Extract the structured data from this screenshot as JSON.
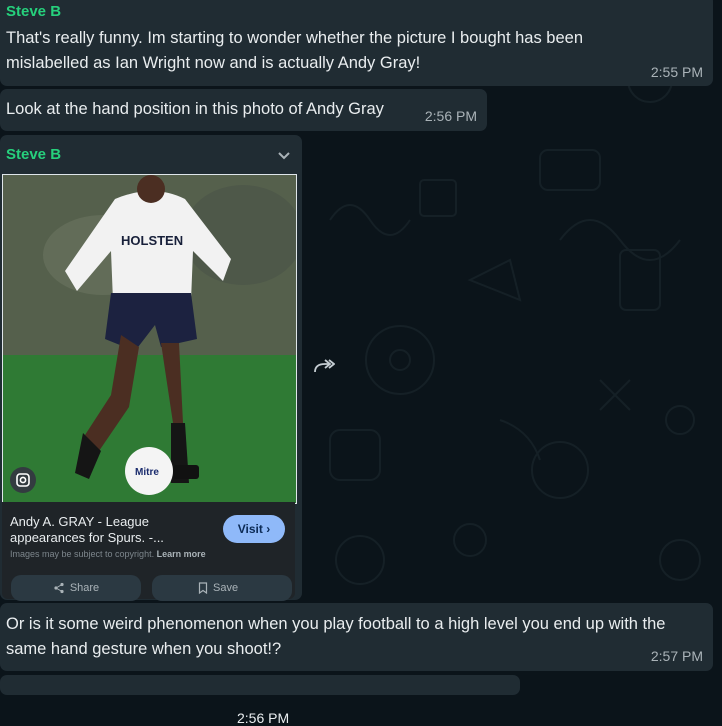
{
  "messages": [
    {
      "sender": "Steve B",
      "text": "That's really funny. Im starting to wonder whether the picture I bought has been mislabelled as Ian Wright now and is actually Andy Gray!",
      "time": "2:55 PM"
    },
    {
      "text": "Look at the hand position in this photo of Andy Gray",
      "time": "2:56 PM"
    },
    {
      "sender": "Steve B",
      "image_shirt_text": "HOLSTEN",
      "ball_text": "Mitre",
      "link_title": "Andy A. GRAY - League appearances for Spurs. -...",
      "link_note": "Images may be subject to copyright.",
      "link_learn_more": "Learn more",
      "visit_label": "Visit ›",
      "share_label": "Share",
      "save_label": "Save",
      "time": "2:56 PM"
    },
    {
      "text": "Or is it some weird phenomenon when you play football to a high level you end up with the same hand gesture when you shoot!?",
      "time": "2:57 PM"
    }
  ],
  "colors": {
    "background": "#0b141a",
    "bubble": "#202c33",
    "sender_name": "#26d07c",
    "time": "#aab3b8",
    "visit_button": "#8fb9f9"
  },
  "icons": [
    "chevron-down-icon",
    "forward-icon",
    "google-lens-icon",
    "share-icon",
    "bookmark-icon"
  ]
}
